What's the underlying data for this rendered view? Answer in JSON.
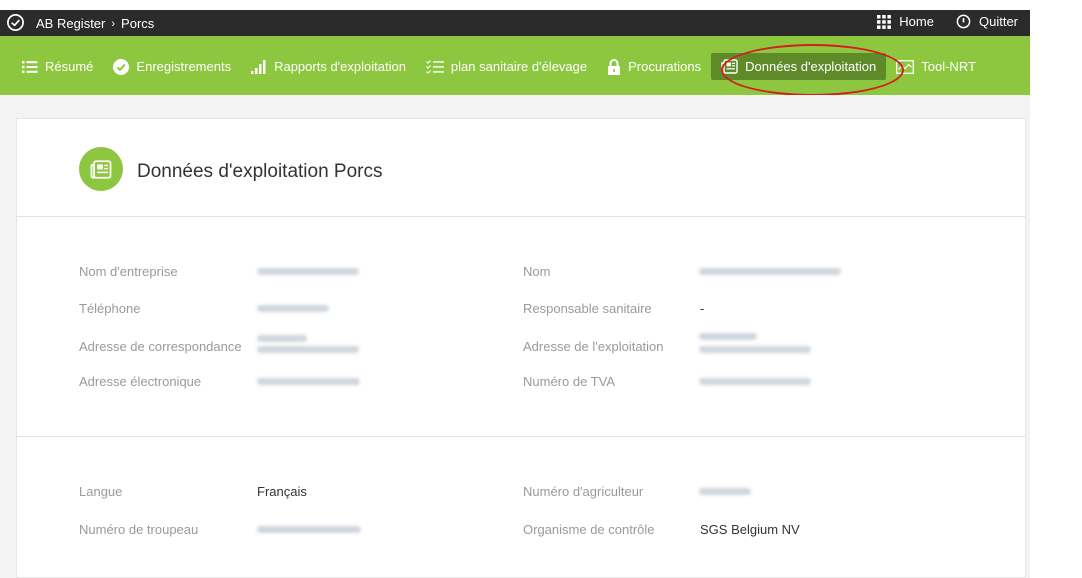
{
  "topbar": {
    "breadcrumb_root": "AB Register",
    "breadcrumb_sep": "›",
    "breadcrumb_current": "Porcs",
    "home_label": "Home",
    "quit_label": "Quitter"
  },
  "nav": {
    "items": [
      {
        "label": "Résumé",
        "icon": "list-icon"
      },
      {
        "label": "Enregistrements",
        "icon": "check-circle-icon"
      },
      {
        "label": "Rapports d'exploitation",
        "icon": "bar-chart-icon"
      },
      {
        "label": "plan sanitaire d'élevage",
        "icon": "checklist-icon"
      },
      {
        "label": "Procurations",
        "icon": "lock-icon"
      },
      {
        "label": "Données d'exploitation",
        "icon": "newspaper-icon",
        "active": true
      },
      {
        "label": "Tool-NRT",
        "icon": "line-chart-icon"
      }
    ]
  },
  "page": {
    "title": "Données d'exploitation Porcs"
  },
  "fields": {
    "company_name_label": "Nom d'entreprise",
    "phone_label": "Téléphone",
    "corr_address_label": "Adresse de correspondance",
    "email_label": "Adresse électronique",
    "name_label": "Nom",
    "health_resp_label": "Responsable sanitaire",
    "health_resp_value": "-",
    "farm_address_label": "Adresse de l'exploitation",
    "vat_label": "Numéro de TVA",
    "language_label": "Langue",
    "language_value": "Français",
    "herd_number_label": "Numéro de troupeau",
    "farmer_number_label": "Numéro d'agriculteur",
    "control_org_label": "Organisme de contrôle",
    "control_org_value": "SGS Belgium NV"
  },
  "colors": {
    "green": "#8dc63f",
    "active_green": "#5f8a2a",
    "topbar": "#2b2b2b",
    "highlight": "#d21f1f"
  }
}
